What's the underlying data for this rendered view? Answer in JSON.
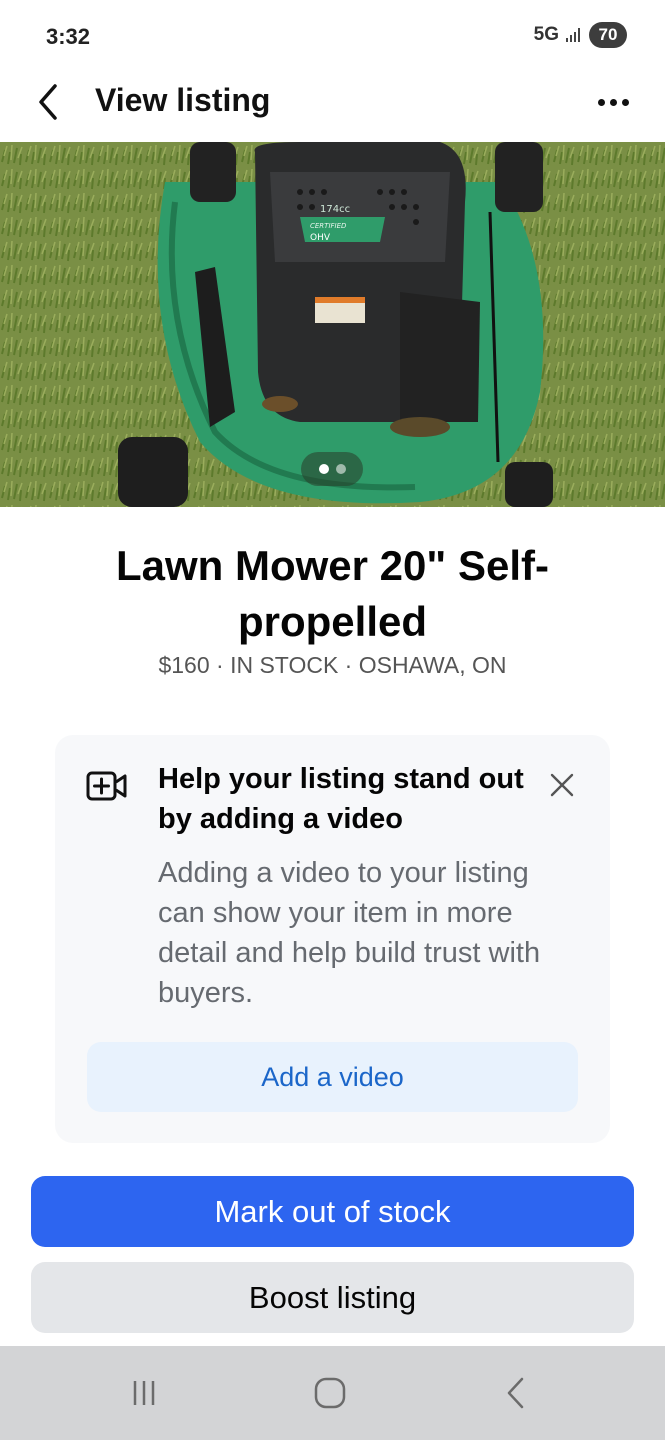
{
  "status_bar": {
    "time": "3:32",
    "network": "5G",
    "battery": "70"
  },
  "header": {
    "title": "View listing",
    "back_icon": "chevron-left-icon",
    "more_icon": "more-horizontal-icon"
  },
  "photo": {
    "pager_count": 2,
    "pager_active": 0,
    "engine_label": "174cc",
    "engine_sub": "CERTIFIED",
    "engine_tag": "OHV"
  },
  "listing": {
    "title": "Lawn Mower 20\" Self-propelled",
    "meta": "$160 · IN STOCK · OSHAWA, ON"
  },
  "video_card": {
    "icon": "add-video-icon",
    "heading": "Help your listing stand out by adding a video",
    "body": "Adding a video to your listing can show your item in more detail and help build trust with buyers.",
    "button": "Add a video",
    "close_icon": "close-icon"
  },
  "actions": {
    "primary": "Mark out of stock",
    "secondary": "Boost listing"
  },
  "nav_bar": {
    "recents_icon": "recents-icon",
    "home_icon": "home-icon",
    "back_icon": "back-icon"
  },
  "colors": {
    "primary": "#2d65f0",
    "link": "#1b66c9",
    "card_bg": "#f7f8fa"
  }
}
